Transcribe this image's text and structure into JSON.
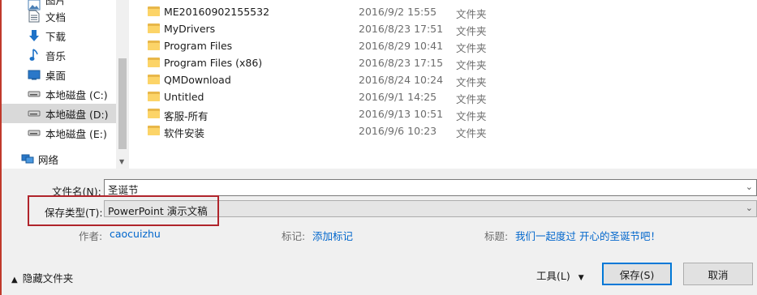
{
  "nav": {
    "items": [
      {
        "label": "图片",
        "icon": "pictures-icon"
      },
      {
        "label": "文档",
        "icon": "documents-icon"
      },
      {
        "label": "下载",
        "icon": "download-icon"
      },
      {
        "label": "音乐",
        "icon": "music-icon"
      },
      {
        "label": "桌面",
        "icon": "desktop-icon"
      },
      {
        "label": "本地磁盘 (C:)",
        "icon": "drive-icon"
      },
      {
        "label": "本地磁盘 (D:)",
        "icon": "drive-icon",
        "selected": true
      },
      {
        "label": "本地磁盘 (E:)",
        "icon": "drive-icon"
      },
      {
        "label": "网络",
        "icon": "network-icon"
      }
    ]
  },
  "files": [
    {
      "name": "ME20160902155532",
      "date": "2016/9/2 15:55",
      "type": "文件夹"
    },
    {
      "name": "MyDrivers",
      "date": "2016/8/23 17:51",
      "type": "文件夹"
    },
    {
      "name": "Program Files",
      "date": "2016/8/29 10:41",
      "type": "文件夹"
    },
    {
      "name": "Program Files (x86)",
      "date": "2016/8/23 17:15",
      "type": "文件夹"
    },
    {
      "name": "QMDownload",
      "date": "2016/8/24 10:24",
      "type": "文件夹"
    },
    {
      "name": "Untitled",
      "date": "2016/9/1 14:25",
      "type": "文件夹"
    },
    {
      "name": "客服-所有",
      "date": "2016/9/13 10:51",
      "type": "文件夹"
    },
    {
      "name": "软件安装",
      "date": "2016/9/6 10:23",
      "type": "文件夹"
    }
  ],
  "form": {
    "filename_label": "文件名(N):",
    "filename_value": "圣诞节",
    "filetype_label": "保存类型(T):",
    "filetype_value": "PowerPoint 演示文稿",
    "author_label": "作者:",
    "author_value": "caocuizhu",
    "tags_label": "标记:",
    "tags_value": "添加标记",
    "title_label": "标题:",
    "title_value": "我们一起度过 开心的圣诞节吧！"
  },
  "footer": {
    "hide_folders": "隐藏文件夹",
    "tools": "工具(L)",
    "save": "保存(S)",
    "cancel": "取消"
  },
  "colors": {
    "highlight_box": "#b0242b",
    "link": "#0066cc",
    "default_button_border": "#0078d7"
  }
}
